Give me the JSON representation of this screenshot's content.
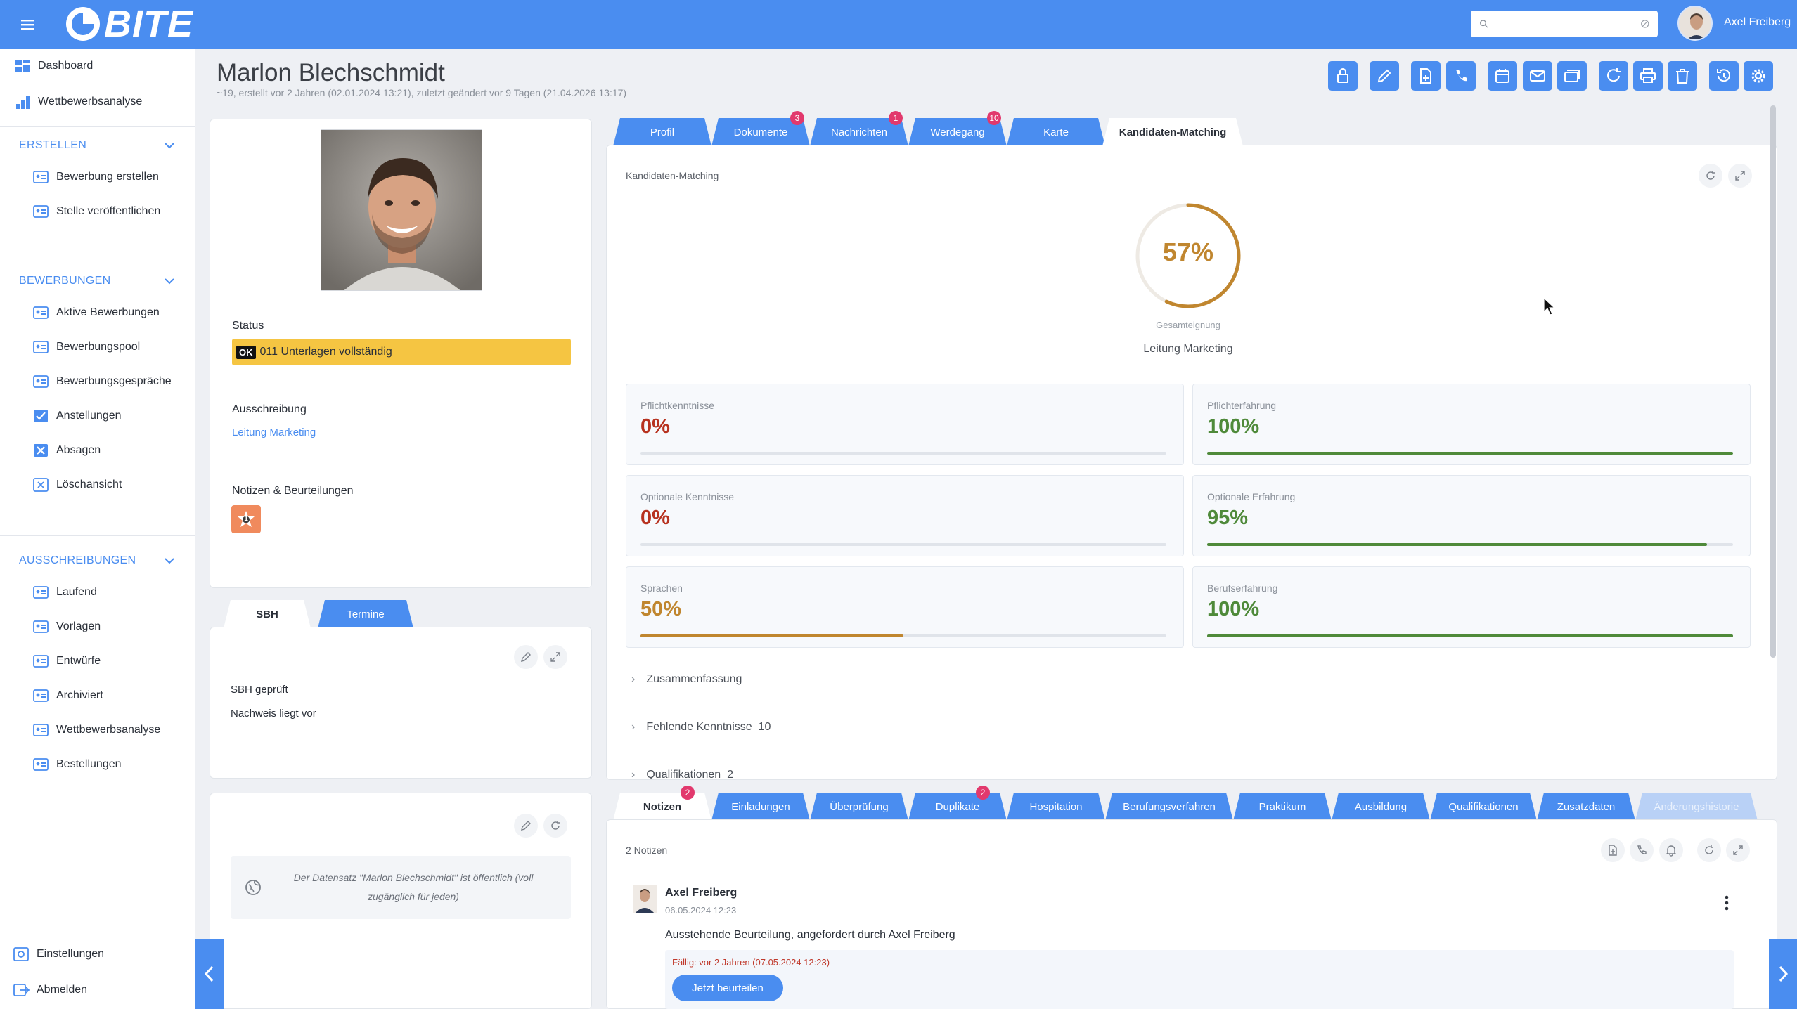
{
  "app": {
    "logo_text": "BITE",
    "brand_color": "#4a8df0",
    "user_name": "Axel Freiberg",
    "search_placeholder": ""
  },
  "sidebar": {
    "dashboard": "Dashboard",
    "wettbewerbsanalyse_top": "Wettbewerbsanalyse",
    "sections": {
      "erstellen": "ERSTELLEN",
      "bewerbungen": "BEWERBUNGEN",
      "ausschreibungen": "AUSSCHREIBUNGEN"
    },
    "erstellen": [
      "Bewerbung erstellen",
      "Stelle veröffentlichen"
    ],
    "bewerbungen": [
      "Aktive Bewerbungen",
      "Bewerbungspool",
      "Bewerbungsgespräche",
      "Anstellungen",
      "Absagen",
      "Löschansicht"
    ],
    "ausschreibungen": [
      "Laufend",
      "Vorlagen",
      "Entwürfe",
      "Archiviert",
      "Wettbewerbsanalyse",
      "Bestellungen"
    ],
    "einstellungen": "Einstellungen",
    "abmelden": "Abmelden"
  },
  "page": {
    "title": "Marlon Blechschmidt",
    "subtitle": "~19, erstellt vor 2 Jahren (02.01.2024 13:21), zuletzt geändert vor 9 Tagen (21.04.2026 13:17)"
  },
  "profile": {
    "status_label": "Status",
    "status_badge": "OK",
    "status_value": "011 Unterlagen vollständig",
    "ausschreibung_label": "Ausschreibung",
    "ausschreibung_value": "Leitung Marketing",
    "notizen_label": "Notizen & Beurteilungen",
    "notizen_count": "1"
  },
  "sbh": {
    "tabs": [
      "SBH",
      "Termine"
    ],
    "title": "SBH geprüft",
    "value": "Nachweis liegt vor"
  },
  "public_notice": "Der Datensatz \"Marlon Blechschmidt\" ist öffentlich (voll zugänglich für jeden)",
  "top_tabs": [
    {
      "label": "Profil",
      "badge": ""
    },
    {
      "label": "Dokumente",
      "badge": "3"
    },
    {
      "label": "Nachrichten",
      "badge": "1"
    },
    {
      "label": "Werdegang",
      "badge": "10"
    },
    {
      "label": "Karte",
      "badge": ""
    },
    {
      "label": "Kandidaten-Matching",
      "badge": ""
    }
  ],
  "matching": {
    "header": "Kandidaten-Matching",
    "overall_percent": "57%",
    "overall_fraction": 0.57,
    "overall_label": "Gesamteignung",
    "position": "Leitung Marketing",
    "metrics": [
      {
        "label": "Pflichtkenntnisse",
        "value": "0%",
        "fraction": 0.0,
        "color": "#b7321f"
      },
      {
        "label": "Pflichterfahrung",
        "value": "100%",
        "fraction": 1.0,
        "color": "#4f8a3a"
      },
      {
        "label": "Optionale Kenntnisse",
        "value": "0%",
        "fraction": 0.0,
        "color": "#b7321f"
      },
      {
        "label": "Optionale Erfahrung",
        "value": "95%",
        "fraction": 0.95,
        "color": "#4f8a3a"
      },
      {
        "label": "Sprachen",
        "value": "50%",
        "fraction": 0.5,
        "color": "#c0862f"
      },
      {
        "label": "Berufserfahrung",
        "value": "100%",
        "fraction": 1.0,
        "color": "#4f8a3a"
      }
    ],
    "accordion": [
      {
        "label": "Zusammenfassung",
        "count": ""
      },
      {
        "label": "Fehlende Kenntnisse",
        "count": "10"
      },
      {
        "label": "Qualifikationen",
        "count": "2"
      }
    ]
  },
  "bottom_tabs": [
    {
      "label": "Notizen",
      "badge": "2"
    },
    {
      "label": "Einladungen",
      "badge": ""
    },
    {
      "label": "Überprüfung",
      "badge": ""
    },
    {
      "label": "Duplikate",
      "badge": "2"
    },
    {
      "label": "Hospitation",
      "badge": ""
    },
    {
      "label": "Berufungsverfahren",
      "badge": ""
    },
    {
      "label": "Praktikum",
      "badge": ""
    },
    {
      "label": "Ausbildung",
      "badge": ""
    },
    {
      "label": "Qualifikationen",
      "badge": ""
    },
    {
      "label": "Zusatzdaten",
      "badge": ""
    },
    {
      "label": "Änderungshistorie",
      "badge": ""
    }
  ],
  "notes": {
    "count_label": "2 Notizen",
    "author": "Axel Freiberg",
    "date": "06.05.2024 12:23",
    "text": "Ausstehende Beurteilung, angefordert durch Axel Freiberg",
    "due": "Fällig: vor 2 Jahren (07.05.2024 12:23)",
    "action": "Jetzt beurteilen"
  }
}
